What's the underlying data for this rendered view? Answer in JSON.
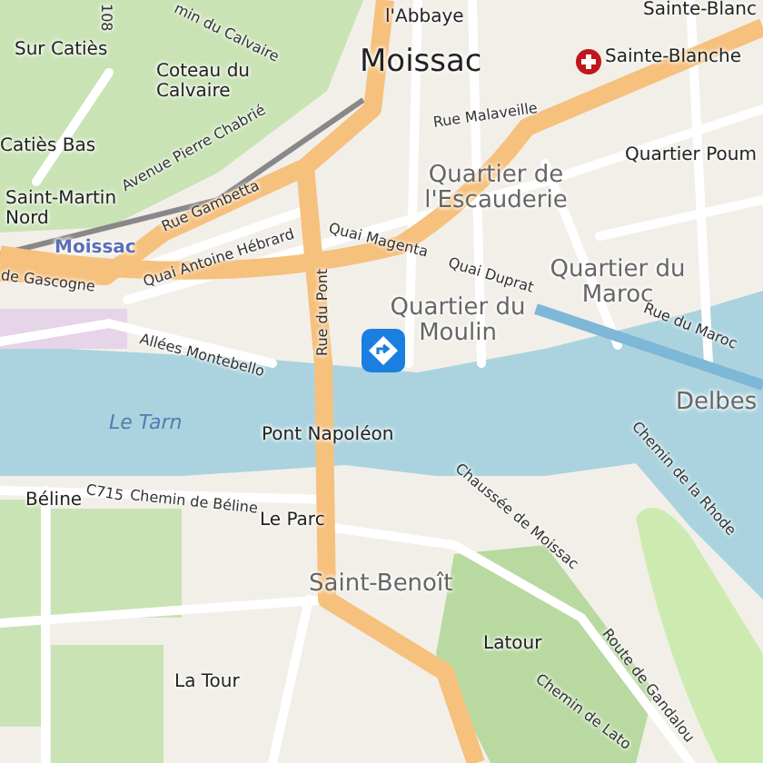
{
  "map": {
    "labels": [
      {
        "text": "108",
        "kind": "street"
      },
      {
        "text": "min du Calvaire",
        "kind": "street"
      },
      {
        "text": "Sur Catiès",
        "kind": "place"
      },
      {
        "text": "Coteau du Calvaire",
        "kind": "place"
      },
      {
        "text": "Catiès Bas",
        "kind": "place"
      },
      {
        "text": "Saint-Martin Nord",
        "kind": "place"
      },
      {
        "text": "Moissac",
        "kind": "station"
      },
      {
        "text": "Avenue Pierre Chabrié",
        "kind": "street"
      },
      {
        "text": "Rue Gambetta",
        "kind": "street"
      },
      {
        "text": "Quai Antoine Hébrard",
        "kind": "street"
      },
      {
        "text": "de Gascogne",
        "kind": "street"
      },
      {
        "text": "Allées Montebello",
        "kind": "street"
      },
      {
        "text": "Rue du Pont",
        "kind": "street"
      },
      {
        "text": "Sainte-Blanc",
        "kind": "place"
      },
      {
        "text": "l'Abbaye",
        "kind": "place"
      },
      {
        "text": "Moissac",
        "kind": "town"
      },
      {
        "text": "Sainte-Blanche",
        "kind": "place"
      },
      {
        "text": "Rue Malaveille",
        "kind": "street"
      },
      {
        "text": "Quartier de l'Escauderie",
        "kind": "district"
      },
      {
        "text": "Quartier Poum",
        "kind": "place"
      },
      {
        "text": "Quai Magenta",
        "kind": "street"
      },
      {
        "text": "Quai Duprat",
        "kind": "street"
      },
      {
        "text": "Quartier du Moulin",
        "kind": "district"
      },
      {
        "text": "Quartier du Maroc",
        "kind": "district"
      },
      {
        "text": "Rue du Maroc",
        "kind": "street"
      },
      {
        "text": "Delbes",
        "kind": "district"
      },
      {
        "text": "Chemin de la Rhode",
        "kind": "street"
      },
      {
        "text": "Le Tarn",
        "kind": "water"
      },
      {
        "text": "Pont Napoléon",
        "kind": "place"
      },
      {
        "text": "Chaussée de Moissac",
        "kind": "street"
      },
      {
        "text": "Béline",
        "kind": "place"
      },
      {
        "text": "C715",
        "kind": "street"
      },
      {
        "text": "Chemin de Béline",
        "kind": "street"
      },
      {
        "text": "Le Parc",
        "kind": "place"
      },
      {
        "text": "Saint-Benoît",
        "kind": "district"
      },
      {
        "text": "Latour",
        "kind": "place"
      },
      {
        "text": "Route de Gandalou",
        "kind": "street"
      },
      {
        "text": "La Tour",
        "kind": "place"
      },
      {
        "text": "Chemin de Lato",
        "kind": "street"
      }
    ]
  }
}
